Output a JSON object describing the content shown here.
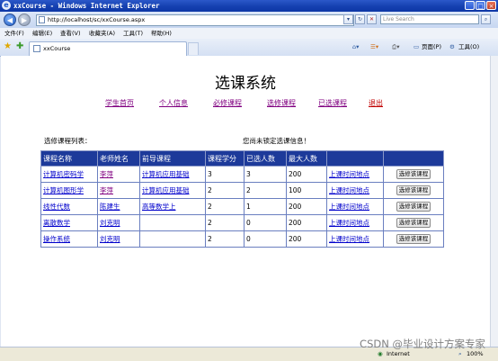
{
  "window": {
    "title": "xxCourse - Windows Internet Explorer",
    "buttons": [
      "_",
      "□",
      "×"
    ]
  },
  "address": {
    "url": "http://localhost/sc/xxCourse.aspx",
    "search_placeholder": "Live Search"
  },
  "menu": {
    "items": [
      "文件(F)",
      "编辑(E)",
      "查看(V)",
      "收藏夹(A)",
      "工具(T)",
      "帮助(H)"
    ]
  },
  "tab": {
    "label": "xxCourse"
  },
  "toolbar": {
    "page_label": "页面(P)",
    "tools_label": "工具(O)"
  },
  "page": {
    "title": "选课系统",
    "nav": [
      "学生首页",
      "个人信息",
      "必修课程",
      "选修课程",
      "已选课程",
      "退出"
    ],
    "list_label": "选修课程列表：",
    "status_text": "您尚未锁定选课信息！",
    "table": {
      "headers": [
        "课程名称",
        "老师姓名",
        "前导课程",
        "课程学分",
        "已选人数",
        "最大人数",
        "",
        ""
      ],
      "rows": [
        [
          "计算机密码学",
          "李萍",
          "计算机应用基础",
          "3",
          "3",
          "200",
          "上课时间地点",
          "选修该课程"
        ],
        [
          "计算机图形学",
          "李萍",
          "计算机应用基础",
          "2",
          "2",
          "100",
          "上课时间地点",
          "选修该课程"
        ],
        [
          "线性代数",
          "陈建生",
          "高等数学上",
          "2",
          "1",
          "200",
          "上课时间地点",
          "选修该课程"
        ],
        [
          "离散数学",
          "刘克明",
          "",
          "2",
          "0",
          "200",
          "上课时间地点",
          "选修该课程"
        ],
        [
          "操作系统",
          "刘克明",
          "",
          "2",
          "0",
          "200",
          "上课时间地点",
          "选修该课程"
        ]
      ]
    }
  },
  "statusbar": {
    "zone": "Internet",
    "zoom": "100%"
  },
  "watermark": "CSDN @毕业设计方案专家",
  "colors": {
    "header_bg": "#1d3a9a",
    "link": "#0000cc",
    "visited": "#800080",
    "exit": "#c00000"
  }
}
